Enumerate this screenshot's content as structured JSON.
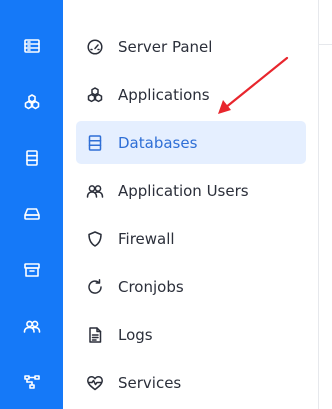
{
  "rail": {
    "items": [
      {
        "icon": "server-icon"
      },
      {
        "icon": "applications-icon"
      },
      {
        "icon": "database-icon"
      },
      {
        "icon": "hard-drive-icon"
      },
      {
        "icon": "archive-icon"
      },
      {
        "icon": "users-icon"
      },
      {
        "icon": "network-icon"
      }
    ]
  },
  "menu": {
    "items": [
      {
        "label": "Server Panel",
        "icon": "gauge-icon",
        "active": false
      },
      {
        "label": "Applications",
        "icon": "cubes-icon",
        "active": false
      },
      {
        "label": "Databases",
        "icon": "database-icon",
        "active": true
      },
      {
        "label": "Application Users",
        "icon": "users-icon",
        "active": false
      },
      {
        "label": "Firewall",
        "icon": "shield-icon",
        "active": false
      },
      {
        "label": "Cronjobs",
        "icon": "refresh-icon",
        "active": false
      },
      {
        "label": "Logs",
        "icon": "file-text-icon",
        "active": false
      },
      {
        "label": "Services",
        "icon": "heart-pulse-icon",
        "active": false
      }
    ]
  },
  "colors": {
    "rail_bg": "#1579f8",
    "active_bg": "#e5efff",
    "active_text": "#2f6fd6",
    "text": "#2b2f3a",
    "annotation_arrow": "#e8262d"
  }
}
